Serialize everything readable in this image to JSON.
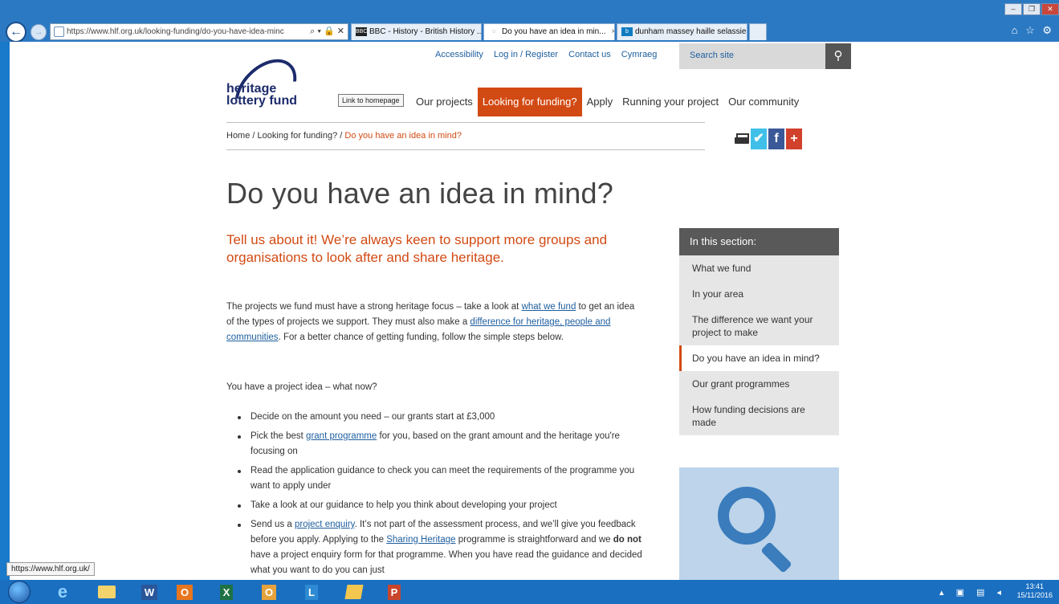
{
  "browser": {
    "address_url": "https://www.hlf.org.uk/looking-funding/do-you-have-idea-minc",
    "address_controls": "⌕ ▾ 🔒 ✕",
    "tabs": [
      {
        "favicon": "BBC",
        "label": "BBC - History - British History ..."
      },
      {
        "favicon": "◌",
        "label": "Do you have an idea in min...",
        "close": "×"
      },
      {
        "favicon": "b",
        "label": "dunham massey haille selassie..."
      }
    ],
    "window_controls": [
      "–",
      "❐",
      "✕"
    ],
    "toolbar_icons": "⌂ ☆ ⚙"
  },
  "site": {
    "util_links": [
      "Accessibility",
      "Log in / Register",
      "Contact us",
      "Cymraeg"
    ],
    "search_placeholder": "Search site",
    "logo_line1": "heritage",
    "logo_line2": "lottery fund",
    "home_tooltip": "Link to homepage",
    "nav": [
      "Our projects",
      "Looking for funding?",
      "Apply",
      "Running your project",
      "Our community"
    ],
    "breadcrumb": {
      "home": "Home",
      "sep": "/",
      "parent": "Looking for funding?",
      "current": "Do you have an idea in mind?"
    }
  },
  "page": {
    "title": "Do you have an idea in mind?",
    "lead": "Tell us about it! We’re always keen to support more groups and organisations to look after and share heritage.",
    "para1": {
      "t1": "The projects we fund must have a strong heritage focus – take a look at ",
      "link1": "what we fund",
      "t2": " to get an idea of the types of projects we support. They must also make a ",
      "link2": "difference for heritage, people and communities",
      "t3": ". For a better chance of getting funding, follow the simple steps below."
    },
    "para2": "You have a project idea – what now?",
    "bullets": {
      "b1": "Decide on the amount you need – our grants start at £3,000",
      "b2_pre": "Pick the best ",
      "b2_link": "grant programme",
      "b2_post": " for you, based on the grant amount and the heritage you're focusing on",
      "b3": "Read the application guidance to check you can meet the requirements of the programme you want to apply under",
      "b4": "Take a look at our guidance to help you think about developing your project",
      "b5_pre": "Send us a ",
      "b5_link1": "project enquiry",
      "b5_mid1": ". It’s not part of the assessment process, and we’ll give you feedback before you apply. Applying to the ",
      "b5_link2": "Sharing Heritage",
      "b5_mid2": " programme is straightforward and we ",
      "b5_bold": "do not",
      "b5_post": " have a project enquiry form for that programme. When you have read the guidance and decided what you want to do you can just"
    },
    "sidebar": {
      "heading": "In this section:",
      "items": [
        "What we fund",
        "In your area",
        "The difference we want your project to make",
        "Do you have an idea in mind?",
        "Our grant programmes",
        "How funding decisions are made"
      ]
    }
  },
  "status_url": "https://www.hlf.org.uk/",
  "clock": {
    "time": "13:41",
    "date": "15/11/2016"
  },
  "colors": {
    "accent": "#d24a13",
    "link": "#1d5e9e",
    "brand": "#1c2b6b"
  }
}
